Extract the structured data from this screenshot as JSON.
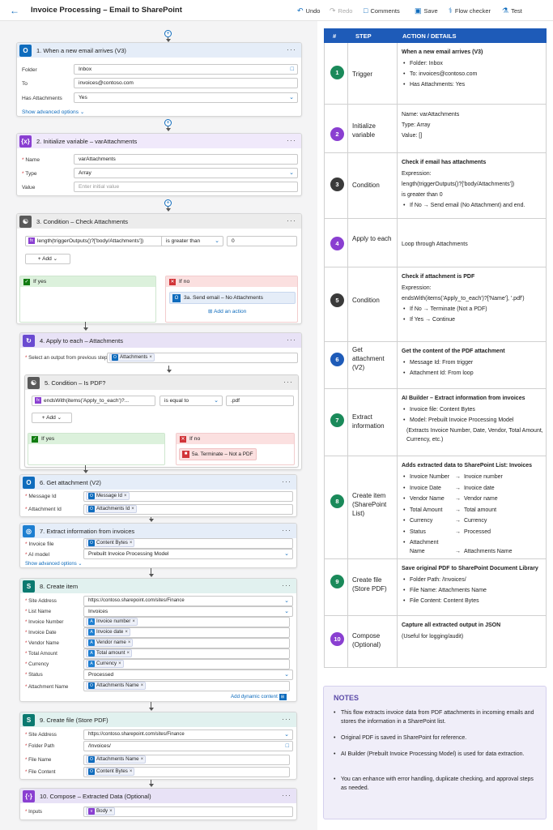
{
  "app": {
    "title": "Invoice Processing – Email to SharePoint"
  },
  "toolbar": {
    "undo": "Undo",
    "redo": "Redo",
    "comments": "Comments",
    "save": "Save",
    "flow_checker": "Flow checker",
    "test": "Test"
  },
  "canvas": {
    "trigger": {
      "title": "1. When a new email arrives (V3)",
      "folder_label": "Folder",
      "folder_value": "Inbox",
      "to_label": "To",
      "to_value": "invoices@contoso.com",
      "attach_label": "Has Attachments",
      "attach_value": "Yes",
      "advanced": "Show advanced options"
    },
    "initvar": {
      "title": "2. Initialize variable – varAttachments",
      "name_label": "Name",
      "name_value": "varAttachments",
      "type_label": "Type",
      "type_value": "Array",
      "value_label": "Value",
      "value_placeholder": "Enter initial value"
    },
    "cond1": {
      "title": "3. Condition – Check Attachments",
      "expr": "length(triggerOutputs()?['body/Attachments'])",
      "op": "is greater than",
      "val": "0",
      "add": "Add",
      "yes": "If yes",
      "no": "If no",
      "no_action": "3a. Send email – No Attachments",
      "add_action": "Add an action"
    },
    "apply": {
      "title": "4. Apply to each – Attachments",
      "select_label": "Select an output from previous steps",
      "token": "Attachments"
    },
    "cond2": {
      "title": "5. Condition – Is PDF?",
      "expr": "endsWith(items('Apply_to_each')?...",
      "op": "is equal to",
      "val": ".pdf",
      "add": "Add",
      "yes": "If yes",
      "no": "If no",
      "no_action": "5a. Terminate – Not a PDF"
    },
    "getatt": {
      "title": "6. Get attachment (V2)",
      "msg_label": "Message Id",
      "msg_token": "Message Id",
      "att_label": "Attachment Id",
      "att_token": "Attachments Id"
    },
    "extract": {
      "title": "7. Extract information from invoices",
      "file_label": "Invoice file",
      "file_token": "Content Bytes",
      "model_label": "AI model",
      "model_value": "Prebuilt Invoice Processing Model",
      "advanced": "Show advanced options"
    },
    "createitem": {
      "title": "8. Create item",
      "site_label": "Site Address",
      "site_value": "https://contoso.sharepoint.com/sites/Finance",
      "list_label": "List Name",
      "list_value": "Invoices",
      "fields": [
        {
          "label": "Invoice Number",
          "token": "Invoice number"
        },
        {
          "label": "Invoice Date",
          "token": "Invoice date"
        },
        {
          "label": "Vendor Name",
          "token": "Vendor name"
        },
        {
          "label": "Total Amount",
          "token": "Total amount"
        },
        {
          "label": "Currency",
          "token": "Currency"
        }
      ],
      "status_label": "Status",
      "status_value": "Processed",
      "attname_label": "Attachment Name",
      "attname_token": "Attachments Name",
      "dynamic": "Add dynamic content"
    },
    "createfile": {
      "title": "9. Create file (Store PDF)",
      "site_label": "Site Address",
      "site_value": "https://contoso.sharepoint.com/sites/Finance",
      "folder_label": "Folder Path",
      "folder_value": "/Invoices/",
      "fname_label": "File Name",
      "fname_token": "Attachments Name",
      "fcontent_label": "File Content",
      "fcontent_token": "Content Bytes"
    },
    "compose": {
      "title": "10. Compose – Extracted Data (Optional)",
      "inputs_label": "Inputs",
      "inputs_token": "Body"
    }
  },
  "table": {
    "headers": [
      "#",
      "STEP",
      "ACTION / DETAILS"
    ],
    "rows": [
      {
        "num": "1",
        "color": "#1a8a5a",
        "step": "Trigger",
        "lines": [
          {
            "t": "b",
            "v": "When a new email arrives (V3)"
          },
          {
            "t": "li",
            "v": "Folder: Inbox"
          },
          {
            "t": "li",
            "v": "To: invoices@contoso.com"
          },
          {
            "t": "li",
            "v": "Has Attachments: Yes"
          }
        ]
      },
      {
        "num": "2",
        "color": "#8a3fd1",
        "step": "Initialize variable",
        "lines": [
          {
            "t": "p",
            "v": "Name: varAttachments"
          },
          {
            "t": "p",
            "v": "Type: Array"
          },
          {
            "t": "p",
            "v": "Value: []"
          }
        ]
      },
      {
        "num": "3",
        "color": "#3a3a3a",
        "step": "Condition",
        "lines": [
          {
            "t": "b",
            "v": "Check if email has attachments"
          },
          {
            "t": "p",
            "v": "Expression:"
          },
          {
            "t": "p",
            "v": "length(triggerOutputs()?['body/Attachments'])"
          },
          {
            "t": "p",
            "v": "is greater than 0"
          },
          {
            "t": "li",
            "v": "If No → Send email (No Attachment) and end."
          }
        ]
      },
      {
        "num": "4",
        "color": "#8a3fd1",
        "step": "Apply to each",
        "lines": [
          {
            "t": "p",
            "v": "Loop through Attachments"
          }
        ]
      },
      {
        "num": "5",
        "color": "#3a3a3a",
        "step": "Condition",
        "lines": [
          {
            "t": "b",
            "v": "Check if attachment is PDF"
          },
          {
            "t": "p",
            "v": "Expression:"
          },
          {
            "t": "p",
            "v": "endsWith(items('Apply_to_each')?['Name'], '.pdf')"
          },
          {
            "t": "li",
            "v": "If No → Terminate (Not a PDF)"
          },
          {
            "t": "li",
            "v": "If Yes → Continue"
          }
        ]
      },
      {
        "num": "6",
        "color": "#1e5bb8",
        "step": "Get attachment (V2)",
        "lines": [
          {
            "t": "b",
            "v": "Get the content of the PDF attachment"
          },
          {
            "t": "li",
            "v": "Message Id: From trigger"
          },
          {
            "t": "li",
            "v": "Attachment Id: From loop"
          }
        ]
      },
      {
        "num": "7",
        "color": "#1a8a5a",
        "step": "Extract information",
        "lines": [
          {
            "t": "b",
            "v": "AI Builder – Extract information from invoices"
          },
          {
            "t": "li",
            "v": "Invoice file: Content Bytes"
          },
          {
            "t": "li",
            "v": "Model: Prebuilt Invoice Processing Model"
          },
          {
            "t": "p2",
            "v": "(Extracts Invoice Number, Date, Vendor, Total Amount, Currency, etc.)"
          }
        ]
      },
      {
        "num": "8",
        "color": "#1a8a5a",
        "step": "Create item (SharePoint List)",
        "lines": [
          {
            "t": "b",
            "v": "Adds extracted data to SharePoint List: Invoices"
          },
          {
            "t": "map",
            "a": "Invoice Number",
            "b": "Invoice number"
          },
          {
            "t": "map",
            "a": "Invoice Date",
            "b": "Invoice date"
          },
          {
            "t": "map",
            "a": "Vendor Name",
            "b": "Vendor name"
          },
          {
            "t": "map",
            "a": "Total Amount",
            "b": "Total amount"
          },
          {
            "t": "map",
            "a": "Currency",
            "b": "Currency"
          },
          {
            "t": "map",
            "a": "Status",
            "b": "Processed"
          },
          {
            "t": "map",
            "a": "Attachment Name",
            "b": "Attachments Name"
          }
        ]
      },
      {
        "num": "9",
        "color": "#1a8a5a",
        "step": "Create file (Store PDF)",
        "lines": [
          {
            "t": "b",
            "v": "Save original PDF to SharePoint Document Library"
          },
          {
            "t": "li",
            "v": "Folder Path: /Invoices/"
          },
          {
            "t": "li",
            "v": "File Name: Attachments Name"
          },
          {
            "t": "li",
            "v": "File Content: Content Bytes"
          }
        ]
      },
      {
        "num": "10",
        "color": "#8a3fd1",
        "step": "Compose (Optional)",
        "lines": [
          {
            "t": "b",
            "v": "Capture all extracted output in JSON"
          },
          {
            "t": "p",
            "v": "(Useful for logging/audit)"
          }
        ]
      }
    ]
  },
  "notes": {
    "title": "NOTES",
    "items": [
      "This flow extracts invoice data from PDF attachments in incoming emails and stores the information in a SharePoint list.",
      "Original PDF is saved in SharePoint for reference.",
      "AI Builder (Prebuilt Invoice Processing Model) is used for data extraction.",
      "You can enhance with error handling, duplicate checking, and approval steps as needed."
    ]
  },
  "colors": {
    "accent": "#0f6cbd",
    "header": "#1e5bb8",
    "outlook": "#0f6cbd",
    "variable": "#8a3fd1",
    "condition": "#5a5a5a",
    "sharepoint": "#0b7a70",
    "ai": "#1e7fd1",
    "yes": "#107c10",
    "no": "#d13438"
  }
}
